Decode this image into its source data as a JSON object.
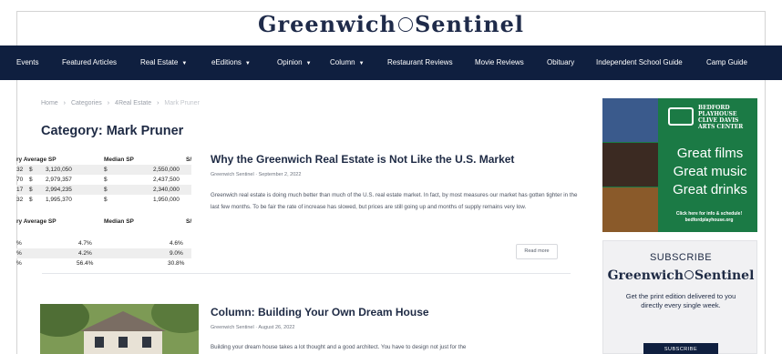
{
  "header": {
    "logo_left": "Greenwich",
    "logo_right": "Sentinel"
  },
  "nav": {
    "items": [
      {
        "label": "Events",
        "caret": false
      },
      {
        "label": "Featured Articles",
        "caret": false
      },
      {
        "label": "Real Estate",
        "caret": true
      },
      {
        "label": "eEditions",
        "caret": true
      },
      {
        "label": "Opinion",
        "caret": true
      },
      {
        "label": "Column",
        "caret": true
      },
      {
        "label": "Restaurant Reviews",
        "caret": false
      },
      {
        "label": "Movie Reviews",
        "caret": false
      },
      {
        "label": "Obituary",
        "caret": false
      },
      {
        "label": "Independent School Guide",
        "caret": false
      },
      {
        "label": "Camp Guide",
        "caret": false
      }
    ],
    "caret_glyph": "▼"
  },
  "breadcrumb": {
    "items": [
      "Home",
      "Categories",
      "4Real Estate",
      "Mark Pruner"
    ],
    "separator": "›"
  },
  "page": {
    "title": "Category: Mark Pruner"
  },
  "sp_table": {
    "header1": [
      "ry Average SP",
      "Median SP",
      "S/"
    ],
    "rows1": [
      [
        "32",
        "$",
        "3,120,050",
        "$",
        "2,550,000"
      ],
      [
        "70",
        "$",
        "2,979,357",
        "$",
        "2,437,500"
      ],
      [
        "17",
        "$",
        "2,994,235",
        "$",
        "2,340,000"
      ],
      [
        "32",
        "$",
        "1,995,370",
        "$",
        "1,950,000"
      ]
    ],
    "header2": [
      "ry Average SP",
      "Median SP",
      "S/"
    ],
    "rows2": [
      [
        "%",
        "4.7%",
        "4.6%"
      ],
      [
        "%",
        "4.2%",
        "9.0%"
      ],
      [
        "%",
        "56.4%",
        "30.8%"
      ]
    ]
  },
  "articles": [
    {
      "title": "Why the Greenwich Real Estate is Not Like the U.S. Market",
      "author": "Greenwich Sentinel",
      "date": "September 2, 2022",
      "excerpt": "Greenwich real estate is doing much better than much of the U.S. real estate market. In fact, by most measures our market has gotten tighter in the last few months. To be fair the rate of increase has slowed, but prices are still going up and months of supply remains very low.",
      "read_more": "Read more"
    },
    {
      "title": "Column: Building Your Own Dream House",
      "author": "Greenwich Sentinel",
      "date": "August 26, 2022",
      "excerpt": "Building your dream house takes a lot thought and a good architect. You have to design not just for the"
    }
  ],
  "meta_separator": "·",
  "ad": {
    "logo_lines": [
      "BEDFORD",
      "PLAYHOUSE",
      "CLIVE DAVIS",
      "ARTS CENTER"
    ],
    "lines": [
      "Great films",
      "Great music",
      "Great drinks"
    ],
    "small_line1": "Click here for info & schedule!",
    "small_line2": "bedfordplayhouse.org",
    "color": "#1b7a45"
  },
  "subscribe": {
    "title": "SUBSCRIBE",
    "logo_left": "Greenwich",
    "logo_right": "Sentinel",
    "text": "Get the print edition delivered to you directly every single week.",
    "button": "SUBSCRIBE"
  },
  "colors": {
    "navy": "#0f1f3f",
    "text": "#1e2a44"
  }
}
